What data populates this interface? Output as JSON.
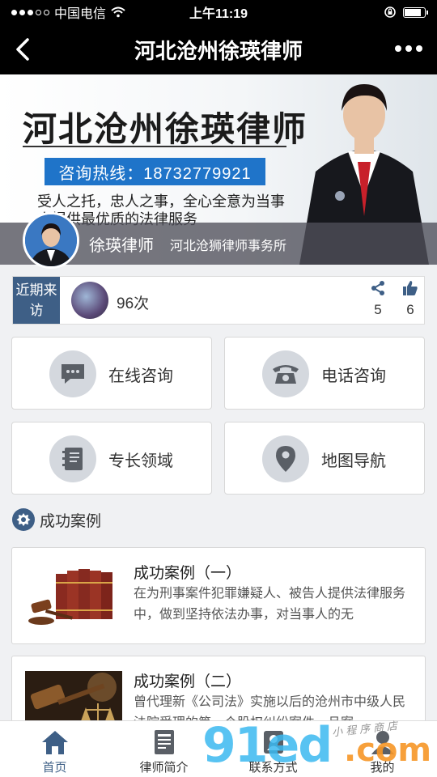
{
  "status_bar": {
    "carrier": "中国电信",
    "time": "上午11:19"
  },
  "nav": {
    "title": "河北沧州徐瑛律师"
  },
  "banner": {
    "headline": "河北沧州徐瑛律师",
    "hotline": "咨询热线：18732779921",
    "slogan": "受人之托，忠人之事，全心全意为当事人提供最优质的法律服务",
    "lawyer_name": "徐瑛律师",
    "firm": "河北沧狮律师事务所"
  },
  "visitors": {
    "label": "近期来访",
    "count": "96次",
    "shares": "5",
    "likes": "6"
  },
  "services": [
    {
      "label": "在线咨询",
      "icon": "chat-icon"
    },
    {
      "label": "电话咨询",
      "icon": "phone-icon"
    },
    {
      "label": "专长领域",
      "icon": "notebook-icon"
    },
    {
      "label": "地图导航",
      "icon": "map-pin-icon"
    }
  ],
  "cases_section": {
    "title": "成功案例"
  },
  "cases": [
    {
      "title": "成功案例（一）",
      "text": "在为刑事案件犯罪嫌疑人、被告人提供法律服务中，做到坚持依法办事，对当事人的无"
    },
    {
      "title": "成功案例（二）",
      "text": "曾代理新《公司法》实施以后的沧州市中级人民法院受理的第一个股权纠纷案件，且案"
    }
  ],
  "tabs": [
    {
      "label": "首页"
    },
    {
      "label": "律师简介"
    },
    {
      "label": "联系方式"
    },
    {
      "label": "我的"
    }
  ],
  "watermark": {
    "main": "91ed",
    "domain": ".com",
    "sub": "小程序商店"
  },
  "colors": {
    "accent": "#3e5f86",
    "hotline_blue": "#1f74c9",
    "icon_circle": "#d4d8de"
  }
}
